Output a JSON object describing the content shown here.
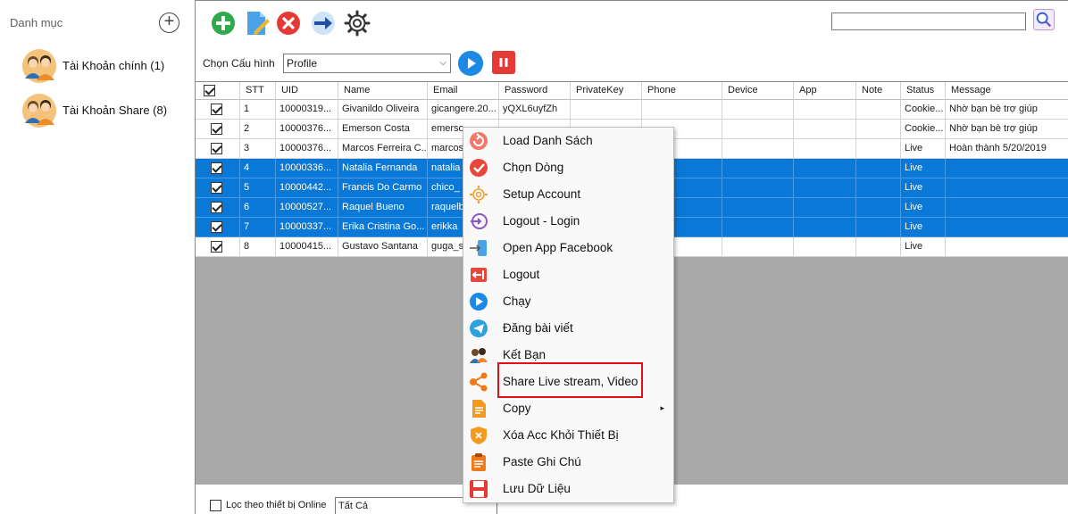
{
  "sidebar": {
    "header": "Danh mục",
    "categories": [
      {
        "label": "Tài Khoản chính  (1)"
      },
      {
        "label": "Tài Khoản Share  (8)"
      }
    ]
  },
  "toolbar": {
    "config_label": "Chọn Cấu hình",
    "config_value": "Profile",
    "search_value": ""
  },
  "grid": {
    "columns": [
      "STT",
      "UID",
      "Name",
      "Email",
      "Password",
      "PrivateKey",
      "Phone",
      "Device",
      "App",
      "Note",
      "Status",
      "Message"
    ],
    "rows": [
      {
        "stt": "1",
        "uid": "10000319...",
        "name": "Givanildo Oliveira",
        "email": "gicangere.20...",
        "password": "yQXL6uyfZh",
        "status": "Cookie...",
        "message": "Nhờ bạn bè trợ giúp",
        "selected": false
      },
      {
        "stt": "2",
        "uid": "10000376...",
        "name": "Emerson Costa",
        "email": "emerso",
        "password": "",
        "status": "Cookie...",
        "message": "Nhờ bạn bè trợ giúp",
        "selected": false
      },
      {
        "stt": "3",
        "uid": "10000376...",
        "name": "Marcos Ferreira C...",
        "email": "marcos",
        "password": "",
        "status": "Live",
        "message": "Hoàn thành 5/20/2019",
        "selected": false
      },
      {
        "stt": "4",
        "uid": "10000336...",
        "name": "Natalia Fernanda",
        "email": "natalia",
        "password": "",
        "status": "Live",
        "message": "",
        "selected": true
      },
      {
        "stt": "5",
        "uid": "10000442...",
        "name": "Francis Do Carmo",
        "email": "chico_",
        "password": "",
        "status": "Live",
        "message": "",
        "selected": true
      },
      {
        "stt": "6",
        "uid": "10000527...",
        "name": "Raquel Bueno",
        "email": "raquelb",
        "password": "",
        "status": "Live",
        "message": "",
        "selected": true
      },
      {
        "stt": "7",
        "uid": "10000337...",
        "name": "Erika Cristina Go...",
        "email": "erikka",
        "password": "",
        "status": "Live",
        "message": "",
        "selected": true
      },
      {
        "stt": "8",
        "uid": "10000415...",
        "name": "Gustavo Santana",
        "email": "guga_s",
        "password": "",
        "status": "Live",
        "message": "",
        "selected": false
      }
    ]
  },
  "bottom": {
    "filter_label": "Lọc theo thiết bị Online",
    "filter_value": "Tất Cả"
  },
  "context_menu": {
    "items": [
      {
        "label": "Load Danh Sách",
        "icon": "refresh-icon"
      },
      {
        "label": "Chọn Dòng",
        "icon": "check-circle-icon"
      },
      {
        "label": "Setup Account",
        "icon": "gear-icon"
      },
      {
        "label": "Logout - Login",
        "icon": "login-icon"
      },
      {
        "label": "Open App Facebook",
        "icon": "open-app-icon"
      },
      {
        "label": "Logout",
        "icon": "logout-icon"
      },
      {
        "label": "Chạy",
        "icon": "play-icon"
      },
      {
        "label": "Đăng bài viết",
        "icon": "send-icon"
      },
      {
        "label": "Kết Bạn",
        "icon": "friends-icon"
      },
      {
        "label": "Share Live stream, Video",
        "icon": "share-icon"
      },
      {
        "label": "Copy",
        "icon": "document-icon",
        "submenu": "▸"
      },
      {
        "label": "Xóa Acc Khỏi Thiết Bị",
        "icon": "shield-remove-icon"
      },
      {
        "label": "Paste Ghi Chú",
        "icon": "clipboard-icon"
      },
      {
        "label": "Lưu Dữ Liệu",
        "icon": "save-icon"
      }
    ]
  },
  "colors": {
    "selection": "#0a78d7",
    "highlight_border": "#e0101b"
  }
}
